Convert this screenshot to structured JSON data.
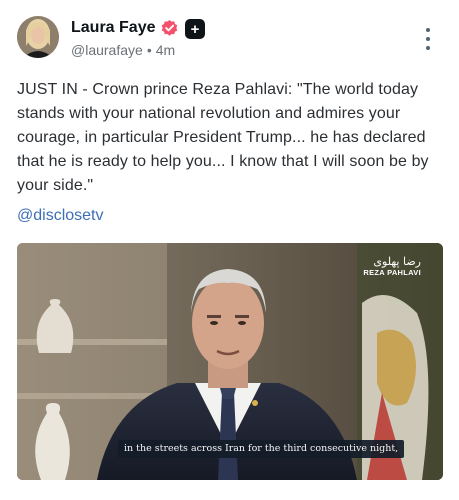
{
  "author": {
    "name": "Laura Faye",
    "handle": "@laurafaye",
    "separator": "•",
    "time": "4m",
    "verified_color": "#f4516c"
  },
  "post": {
    "text": "JUST IN - Crown prince Reza Pahlavi: \"The world today stands with your national revolution and admires your courage, in particular President Trump... he has declared that he is ready to help you... I know that I will soon be by your side.\"",
    "mention": "@disclosetv"
  },
  "media": {
    "channel_script": "رضا پهلوی",
    "channel_name": "REZA PAHLAVI",
    "caption": "in the streets across Iran for the third consecutive night,"
  },
  "icons": {
    "verified": "verified-check-icon",
    "plus": "plus-badge-icon",
    "more": "more-vertical-icon"
  },
  "colors": {
    "link": "#3b6fb6",
    "text": "#2b2f33",
    "muted": "#6b7177"
  }
}
